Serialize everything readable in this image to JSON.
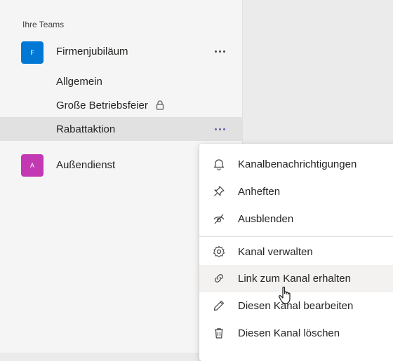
{
  "sidebar": {
    "section_title": "Ihre Teams",
    "teams": [
      {
        "initial": "F",
        "name": "Firmenjubiläum",
        "color": "#0078d4"
      },
      {
        "initial": "A",
        "name": "Außendienst",
        "color": "#c239b3"
      }
    ],
    "channels": [
      {
        "name": "Allgemein"
      },
      {
        "name": "Große Betriebsfeier",
        "icon": "lock-icon"
      },
      {
        "name": "Rabattaktion"
      }
    ],
    "more_icon": "more-options-icon"
  },
  "context_menu": {
    "items": [
      {
        "label": "Kanalbenachrichtigungen",
        "icon": "bell-icon"
      },
      {
        "label": "Anheften",
        "icon": "pin-icon"
      },
      {
        "label": "Ausblenden",
        "icon": "hide-icon"
      },
      {
        "label": "Kanal verwalten",
        "icon": "gear-icon"
      },
      {
        "label": "Link zum Kanal erhalten",
        "icon": "link-icon"
      },
      {
        "label": "Diesen Kanal bearbeiten",
        "icon": "pencil-icon"
      },
      {
        "label": "Diesen Kanal löschen",
        "icon": "trash-icon"
      }
    ]
  },
  "colors": {
    "accent": "#6264a7",
    "hover_background": "#f3f2f1",
    "selected_channel": "#e1e1e1"
  }
}
